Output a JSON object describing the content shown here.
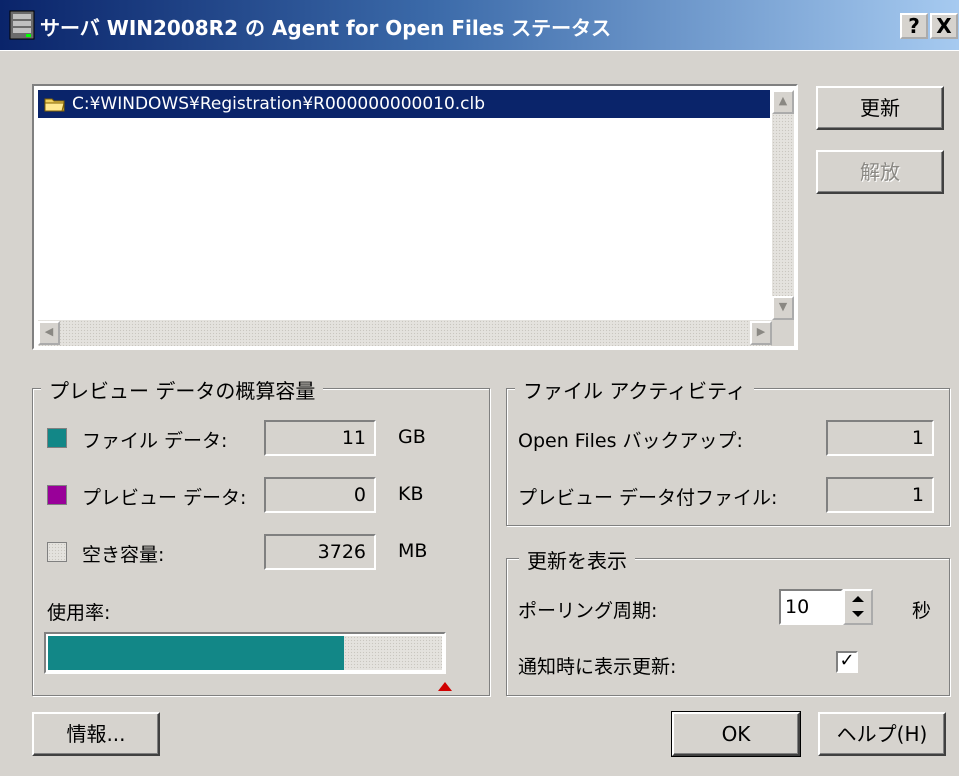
{
  "window": {
    "title": "サーバ WIN2008R2 の Agent for Open Files ステータス",
    "help_glyph": "?",
    "close_glyph": "X"
  },
  "file_list": {
    "items": [
      {
        "path": "C:¥WINDOWS¥Registration¥R000000000010.clb",
        "icon": "folder-icon",
        "selected": true
      }
    ]
  },
  "side_buttons": {
    "refresh": "更新",
    "release": "解放"
  },
  "preview_group": {
    "title": "プレビュー データの概算容量",
    "rows": [
      {
        "label": "ファイル データ:",
        "value": "11",
        "unit": "GB",
        "color": "#128787"
      },
      {
        "label": "プレビュー データ:",
        "value": "0",
        "unit": "KB",
        "color": "#990099"
      },
      {
        "label": "空き容量:",
        "value": "3726",
        "unit": "MB",
        "color": "#d4d2cd"
      }
    ],
    "usage_label": "使用率:",
    "usage_fraction": 0.75
  },
  "activity_group": {
    "title": "ファイル アクティビティ",
    "rows": [
      {
        "label": "Open Files バックアップ:",
        "value": "1"
      },
      {
        "label": "プレビュー データ付ファイル:",
        "value": "1"
      }
    ]
  },
  "refresh_group": {
    "title": "更新を表示",
    "polling_label": "ポーリング周期:",
    "polling_value": "10",
    "polling_unit": "秒",
    "notify_label": "通知時に表示更新:",
    "notify_checked": true,
    "check_glyph": "✓"
  },
  "footer": {
    "info": "情報...",
    "ok": "OK",
    "help": "ヘルプ(H)"
  }
}
